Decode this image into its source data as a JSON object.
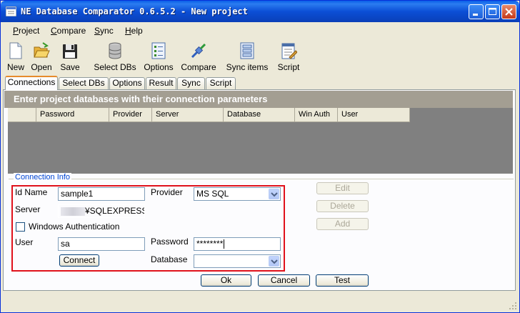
{
  "window": {
    "title": "NE Database Comparator 0.6.5.2 - New project"
  },
  "menu": {
    "items": [
      {
        "label_u": "P",
        "label_rest": "roject"
      },
      {
        "label_u": "C",
        "label_rest": "ompare"
      },
      {
        "label_u": "S",
        "label_rest": "ync"
      },
      {
        "label_u": "H",
        "label_rest": "elp"
      }
    ]
  },
  "toolbar": {
    "items": [
      {
        "label": "New",
        "icon": "new-document-icon"
      },
      {
        "label": "Open",
        "icon": "open-folder-icon"
      },
      {
        "label": "Save",
        "icon": "save-disk-icon"
      },
      {
        "label": "Select DBs",
        "icon": "database-icon"
      },
      {
        "label": "Options",
        "icon": "options-icon"
      },
      {
        "label": "Compare",
        "icon": "compare-icon"
      },
      {
        "label": "Sync items",
        "icon": "sync-items-icon"
      },
      {
        "label": "Script",
        "icon": "script-icon"
      }
    ]
  },
  "tabs": {
    "items": [
      "Connections",
      "Select DBs",
      "Options",
      "Result",
      "Sync",
      "Script"
    ],
    "active": "Connections"
  },
  "connections": {
    "caption": "Enter project databases with their connection parameters",
    "columns": [
      "Password",
      "Provider",
      "Server",
      "Database",
      "Win Auth",
      "User"
    ]
  },
  "connection_info": {
    "legend": "Connection Info",
    "id_name_label": "Id Name",
    "id_name_value": "sample1",
    "server_label": "Server",
    "server_value": "¥SQLEXPRESS",
    "windows_auth_label": "Windows Authentication",
    "windows_auth_checked": false,
    "user_label": "User",
    "user_value": "sa",
    "connect_label": "Connect",
    "provider_label": "Provider",
    "provider_value": "MS SQL",
    "password_label": "Password",
    "password_value": "********",
    "database_label": "Database",
    "database_value": ""
  },
  "side_buttons": {
    "edit": "Edit",
    "delete": "Delete",
    "add": "Add"
  },
  "footer_buttons": {
    "ok": "Ok",
    "cancel": "Cancel",
    "test": "Test"
  },
  "colors": {
    "title_bar": "#0a4fd6",
    "highlight_border": "#e0111b",
    "caption_bg": "#a39e92",
    "legend_text": "#0046d5"
  }
}
